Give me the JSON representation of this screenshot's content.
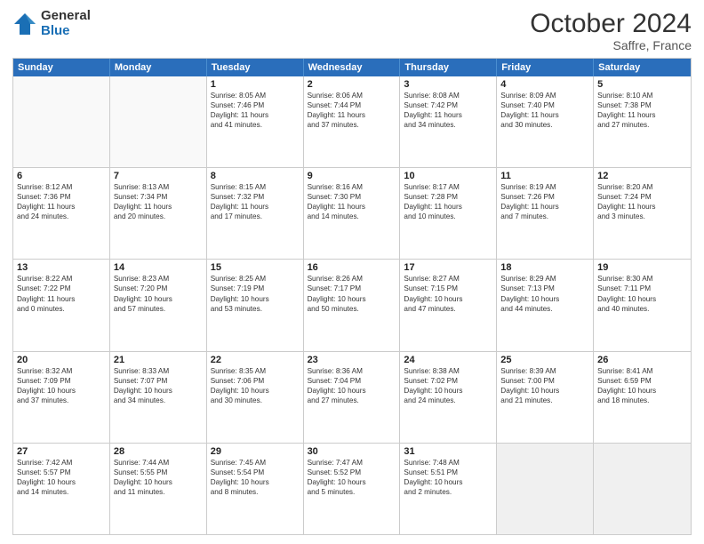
{
  "logo": {
    "general": "General",
    "blue": "Blue"
  },
  "title": "October 2024",
  "subtitle": "Saffre, France",
  "header_days": [
    "Sunday",
    "Monday",
    "Tuesday",
    "Wednesday",
    "Thursday",
    "Friday",
    "Saturday"
  ],
  "weeks": [
    [
      {
        "day": "",
        "lines": [],
        "empty": true
      },
      {
        "day": "",
        "lines": [],
        "empty": true
      },
      {
        "day": "1",
        "lines": [
          "Sunrise: 8:05 AM",
          "Sunset: 7:46 PM",
          "Daylight: 11 hours",
          "and 41 minutes."
        ]
      },
      {
        "day": "2",
        "lines": [
          "Sunrise: 8:06 AM",
          "Sunset: 7:44 PM",
          "Daylight: 11 hours",
          "and 37 minutes."
        ]
      },
      {
        "day": "3",
        "lines": [
          "Sunrise: 8:08 AM",
          "Sunset: 7:42 PM",
          "Daylight: 11 hours",
          "and 34 minutes."
        ]
      },
      {
        "day": "4",
        "lines": [
          "Sunrise: 8:09 AM",
          "Sunset: 7:40 PM",
          "Daylight: 11 hours",
          "and 30 minutes."
        ]
      },
      {
        "day": "5",
        "lines": [
          "Sunrise: 8:10 AM",
          "Sunset: 7:38 PM",
          "Daylight: 11 hours",
          "and 27 minutes."
        ]
      }
    ],
    [
      {
        "day": "6",
        "lines": [
          "Sunrise: 8:12 AM",
          "Sunset: 7:36 PM",
          "Daylight: 11 hours",
          "and 24 minutes."
        ]
      },
      {
        "day": "7",
        "lines": [
          "Sunrise: 8:13 AM",
          "Sunset: 7:34 PM",
          "Daylight: 11 hours",
          "and 20 minutes."
        ]
      },
      {
        "day": "8",
        "lines": [
          "Sunrise: 8:15 AM",
          "Sunset: 7:32 PM",
          "Daylight: 11 hours",
          "and 17 minutes."
        ]
      },
      {
        "day": "9",
        "lines": [
          "Sunrise: 8:16 AM",
          "Sunset: 7:30 PM",
          "Daylight: 11 hours",
          "and 14 minutes."
        ]
      },
      {
        "day": "10",
        "lines": [
          "Sunrise: 8:17 AM",
          "Sunset: 7:28 PM",
          "Daylight: 11 hours",
          "and 10 minutes."
        ]
      },
      {
        "day": "11",
        "lines": [
          "Sunrise: 8:19 AM",
          "Sunset: 7:26 PM",
          "Daylight: 11 hours",
          "and 7 minutes."
        ]
      },
      {
        "day": "12",
        "lines": [
          "Sunrise: 8:20 AM",
          "Sunset: 7:24 PM",
          "Daylight: 11 hours",
          "and 3 minutes."
        ]
      }
    ],
    [
      {
        "day": "13",
        "lines": [
          "Sunrise: 8:22 AM",
          "Sunset: 7:22 PM",
          "Daylight: 11 hours",
          "and 0 minutes."
        ]
      },
      {
        "day": "14",
        "lines": [
          "Sunrise: 8:23 AM",
          "Sunset: 7:20 PM",
          "Daylight: 10 hours",
          "and 57 minutes."
        ]
      },
      {
        "day": "15",
        "lines": [
          "Sunrise: 8:25 AM",
          "Sunset: 7:19 PM",
          "Daylight: 10 hours",
          "and 53 minutes."
        ]
      },
      {
        "day": "16",
        "lines": [
          "Sunrise: 8:26 AM",
          "Sunset: 7:17 PM",
          "Daylight: 10 hours",
          "and 50 minutes."
        ]
      },
      {
        "day": "17",
        "lines": [
          "Sunrise: 8:27 AM",
          "Sunset: 7:15 PM",
          "Daylight: 10 hours",
          "and 47 minutes."
        ]
      },
      {
        "day": "18",
        "lines": [
          "Sunrise: 8:29 AM",
          "Sunset: 7:13 PM",
          "Daylight: 10 hours",
          "and 44 minutes."
        ]
      },
      {
        "day": "19",
        "lines": [
          "Sunrise: 8:30 AM",
          "Sunset: 7:11 PM",
          "Daylight: 10 hours",
          "and 40 minutes."
        ]
      }
    ],
    [
      {
        "day": "20",
        "lines": [
          "Sunrise: 8:32 AM",
          "Sunset: 7:09 PM",
          "Daylight: 10 hours",
          "and 37 minutes."
        ]
      },
      {
        "day": "21",
        "lines": [
          "Sunrise: 8:33 AM",
          "Sunset: 7:07 PM",
          "Daylight: 10 hours",
          "and 34 minutes."
        ]
      },
      {
        "day": "22",
        "lines": [
          "Sunrise: 8:35 AM",
          "Sunset: 7:06 PM",
          "Daylight: 10 hours",
          "and 30 minutes."
        ]
      },
      {
        "day": "23",
        "lines": [
          "Sunrise: 8:36 AM",
          "Sunset: 7:04 PM",
          "Daylight: 10 hours",
          "and 27 minutes."
        ]
      },
      {
        "day": "24",
        "lines": [
          "Sunrise: 8:38 AM",
          "Sunset: 7:02 PM",
          "Daylight: 10 hours",
          "and 24 minutes."
        ]
      },
      {
        "day": "25",
        "lines": [
          "Sunrise: 8:39 AM",
          "Sunset: 7:00 PM",
          "Daylight: 10 hours",
          "and 21 minutes."
        ]
      },
      {
        "day": "26",
        "lines": [
          "Sunrise: 8:41 AM",
          "Sunset: 6:59 PM",
          "Daylight: 10 hours",
          "and 18 minutes."
        ]
      }
    ],
    [
      {
        "day": "27",
        "lines": [
          "Sunrise: 7:42 AM",
          "Sunset: 5:57 PM",
          "Daylight: 10 hours",
          "and 14 minutes."
        ]
      },
      {
        "day": "28",
        "lines": [
          "Sunrise: 7:44 AM",
          "Sunset: 5:55 PM",
          "Daylight: 10 hours",
          "and 11 minutes."
        ]
      },
      {
        "day": "29",
        "lines": [
          "Sunrise: 7:45 AM",
          "Sunset: 5:54 PM",
          "Daylight: 10 hours",
          "and 8 minutes."
        ]
      },
      {
        "day": "30",
        "lines": [
          "Sunrise: 7:47 AM",
          "Sunset: 5:52 PM",
          "Daylight: 10 hours",
          "and 5 minutes."
        ]
      },
      {
        "day": "31",
        "lines": [
          "Sunrise: 7:48 AM",
          "Sunset: 5:51 PM",
          "Daylight: 10 hours",
          "and 2 minutes."
        ]
      },
      {
        "day": "",
        "lines": [],
        "empty": true,
        "shaded": true
      },
      {
        "day": "",
        "lines": [],
        "empty": true,
        "shaded": true
      }
    ]
  ]
}
